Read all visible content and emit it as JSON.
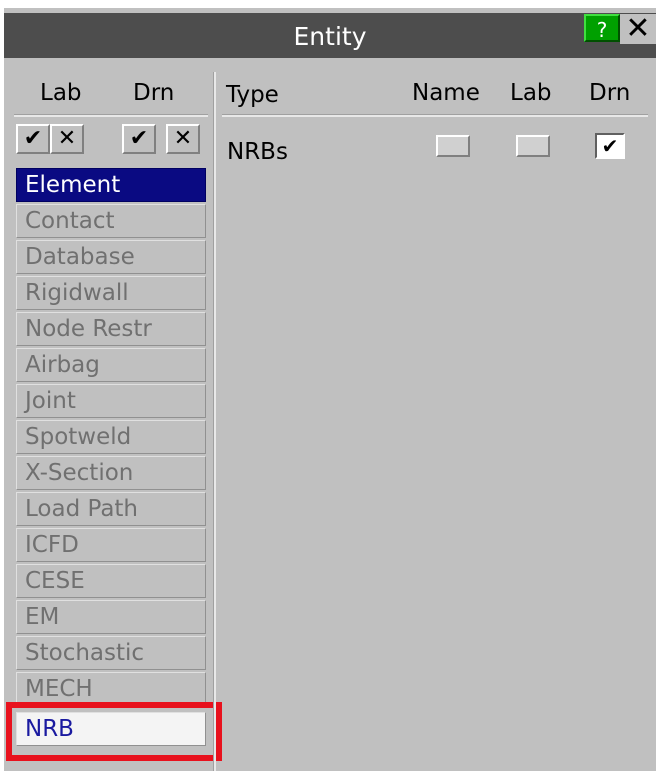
{
  "window": {
    "title": "Entity",
    "help_label": "?",
    "close_label": "✕"
  },
  "left": {
    "headers": {
      "lab": "Lab",
      "drn": "Drn"
    },
    "buttons": {
      "lab_all": "✔",
      "lab_none": "✕",
      "drn_all": "✔",
      "drn_none": "✕"
    },
    "items": [
      {
        "label": "Element"
      },
      {
        "label": "Contact"
      },
      {
        "label": "Database"
      },
      {
        "label": "Rigidwall"
      },
      {
        "label": "Node Restr"
      },
      {
        "label": "Airbag"
      },
      {
        "label": "Joint"
      },
      {
        "label": "Spotweld"
      },
      {
        "label": "X-Section"
      },
      {
        "label": "Load Path"
      },
      {
        "label": "ICFD"
      },
      {
        "label": "CESE"
      },
      {
        "label": "EM"
      },
      {
        "label": "Stochastic"
      },
      {
        "label": "MECH"
      },
      {
        "label": "NRB"
      }
    ],
    "selected": "Element",
    "highlighted": "NRB"
  },
  "table": {
    "headers": {
      "type": "Type",
      "name": "Name",
      "lab": "Lab",
      "drn": "Drn"
    },
    "rows": [
      {
        "type": "NRBs",
        "name_checked": false,
        "lab_checked": false,
        "drn_checked": true,
        "drn_mark": "✔"
      }
    ]
  },
  "colors": {
    "panel": "#c0c0c0",
    "titlebar": "#4d4d4d",
    "selected": "#0a0a82",
    "help": "#00a000",
    "highlight": "#e8111d"
  }
}
